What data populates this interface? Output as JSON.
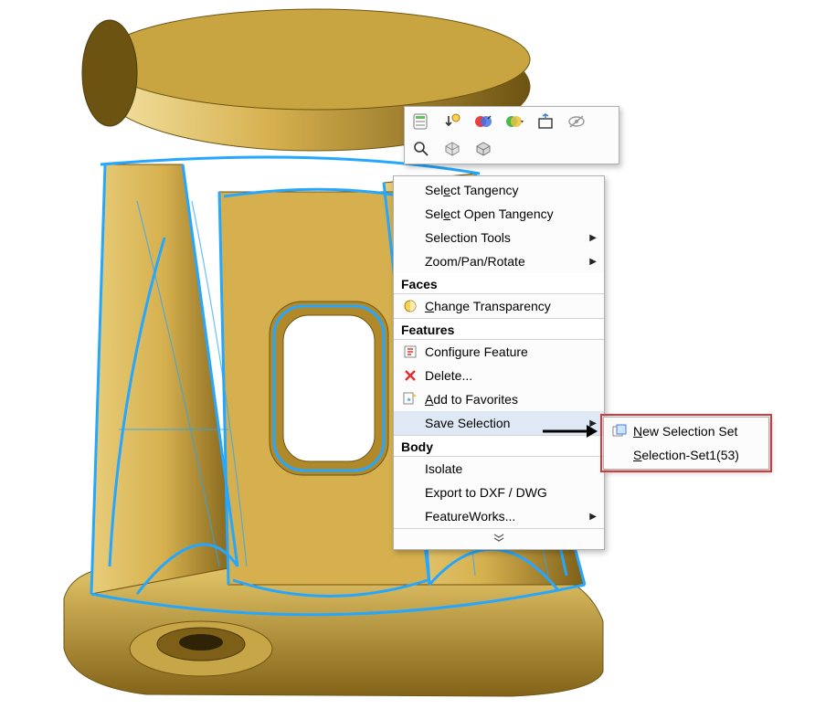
{
  "toolbar_icons": [
    "properties-icon",
    "sort-icon",
    "appearance-icon",
    "color-dropdown-icon",
    "normal-to-icon",
    "hide-icon",
    "zoom-icon",
    "box-icon",
    "box2-icon"
  ],
  "context": {
    "items": [
      {
        "label": "Select Tangency",
        "hotkey_idx": 3
      },
      {
        "label": "Select Open Tangency",
        "hotkey_idx": 3
      },
      {
        "label": "Selection Tools",
        "submenu": true
      },
      {
        "label": "Zoom/Pan/Rotate",
        "submenu": true
      }
    ],
    "faces_header": "Faces",
    "faces_items": [
      {
        "label": "Change Transparency",
        "icon": "transparency-icon",
        "hotkey_idx": 0
      }
    ],
    "features_header": "Features",
    "features_items": [
      {
        "label": "Configure Feature",
        "icon": "configure-icon"
      },
      {
        "label": "Delete...",
        "icon": "delete-icon"
      },
      {
        "label": "Add to Favorites",
        "icon": "favorite-icon",
        "hotkey_idx": 0
      },
      {
        "label": "Save Selection",
        "submenu": true,
        "hover": true
      }
    ],
    "body_header": "Body",
    "body_items": [
      {
        "label": "Isolate"
      },
      {
        "label": "Export to DXF / DWG"
      },
      {
        "label": "FeatureWorks...",
        "submenu": true
      }
    ]
  },
  "submenu": {
    "items": [
      {
        "label": "New Selection Set",
        "icon": "selection-set-icon",
        "hotkey_idx": 0
      },
      {
        "label": "Selection-Set1(53)",
        "hotkey_idx": 0
      }
    ]
  },
  "colors": {
    "part": "#d6b04e",
    "part_dark": "#a88528",
    "edge": "#25a7ff",
    "highlight_box": "#d53a3a"
  }
}
